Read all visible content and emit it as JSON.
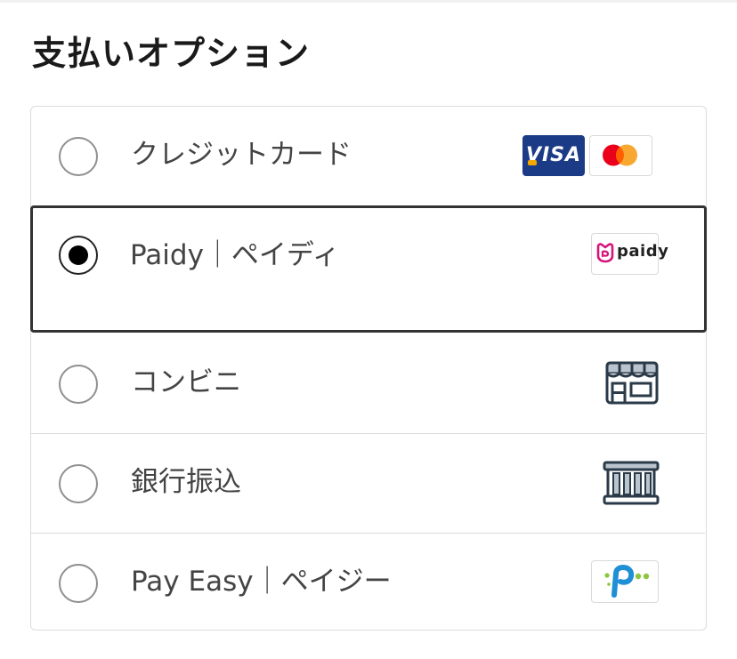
{
  "section": {
    "title": "支払いオプション"
  },
  "options": [
    {
      "label": "クレジットカード",
      "selected": false,
      "icons": [
        "visa-icon",
        "mastercard-icon"
      ]
    },
    {
      "label": "Paidy｜ペイディ",
      "selected": true,
      "icons": [
        "paidy-logo"
      ]
    },
    {
      "label": "コンビニ",
      "selected": false,
      "icons": [
        "convenience-store-icon"
      ]
    },
    {
      "label": "銀行振込",
      "selected": false,
      "icons": [
        "bank-icon"
      ]
    },
    {
      "label": "Pay Easy｜ペイジー",
      "selected": false,
      "icons": [
        "payeasy-logo"
      ]
    }
  ],
  "logos": {
    "visa_text": "VISA",
    "paidy_text": "paidy"
  },
  "colors": {
    "visa_blue": "#1b3b86",
    "mastercard_red": "#eb001b",
    "mastercard_orange": "#f79e1b",
    "paidy_magenta": "#d6157c",
    "icon_dark": "#2a3a48",
    "icon_gray": "#b9c4cf",
    "payeasy_blue": "#1f8fd6",
    "payeasy_green": "#8cc63f",
    "selected_border": "#333333",
    "divider": "#dcdcdc"
  }
}
